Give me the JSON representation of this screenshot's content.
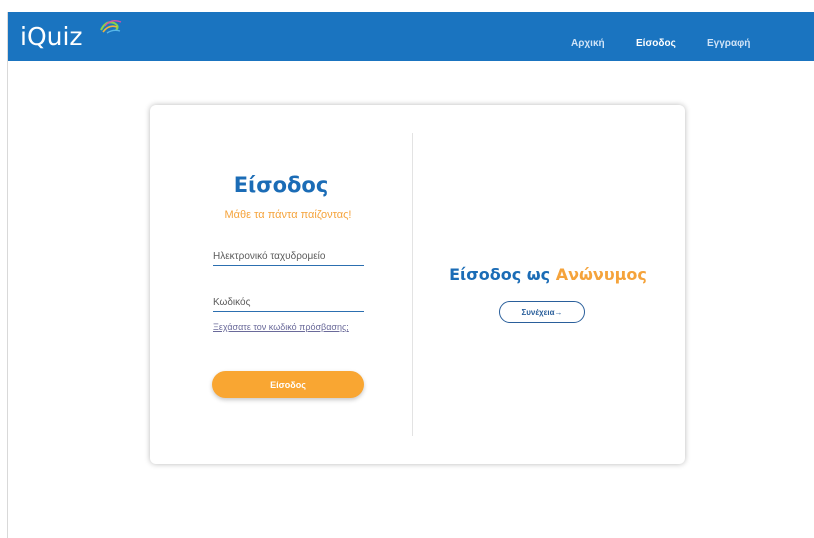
{
  "navbar": {
    "brand": "iQuiz",
    "links": [
      {
        "label": "Αρχική"
      },
      {
        "label": "Είσοδος"
      },
      {
        "label": "Εγγραφή"
      }
    ]
  },
  "login": {
    "title": "Είσοδος",
    "subtitle": "Μάθε τα πάντα παίζοντας!",
    "email_placeholder": "Ηλεκτρονικό ταχυδρομείο",
    "password_placeholder": "Κωδικός",
    "forgot_label": "Ξεχάσατε τον κωδικό πρόσβασης;",
    "submit_label": "Είσοδος"
  },
  "anonymous": {
    "title_prefix": "Είσοδος ως",
    "title_accent": "Ανώνυμος",
    "continue_label": "Συνέχεια→"
  },
  "colors": {
    "primary": "#1a74c0",
    "accent": "#f9a632"
  }
}
